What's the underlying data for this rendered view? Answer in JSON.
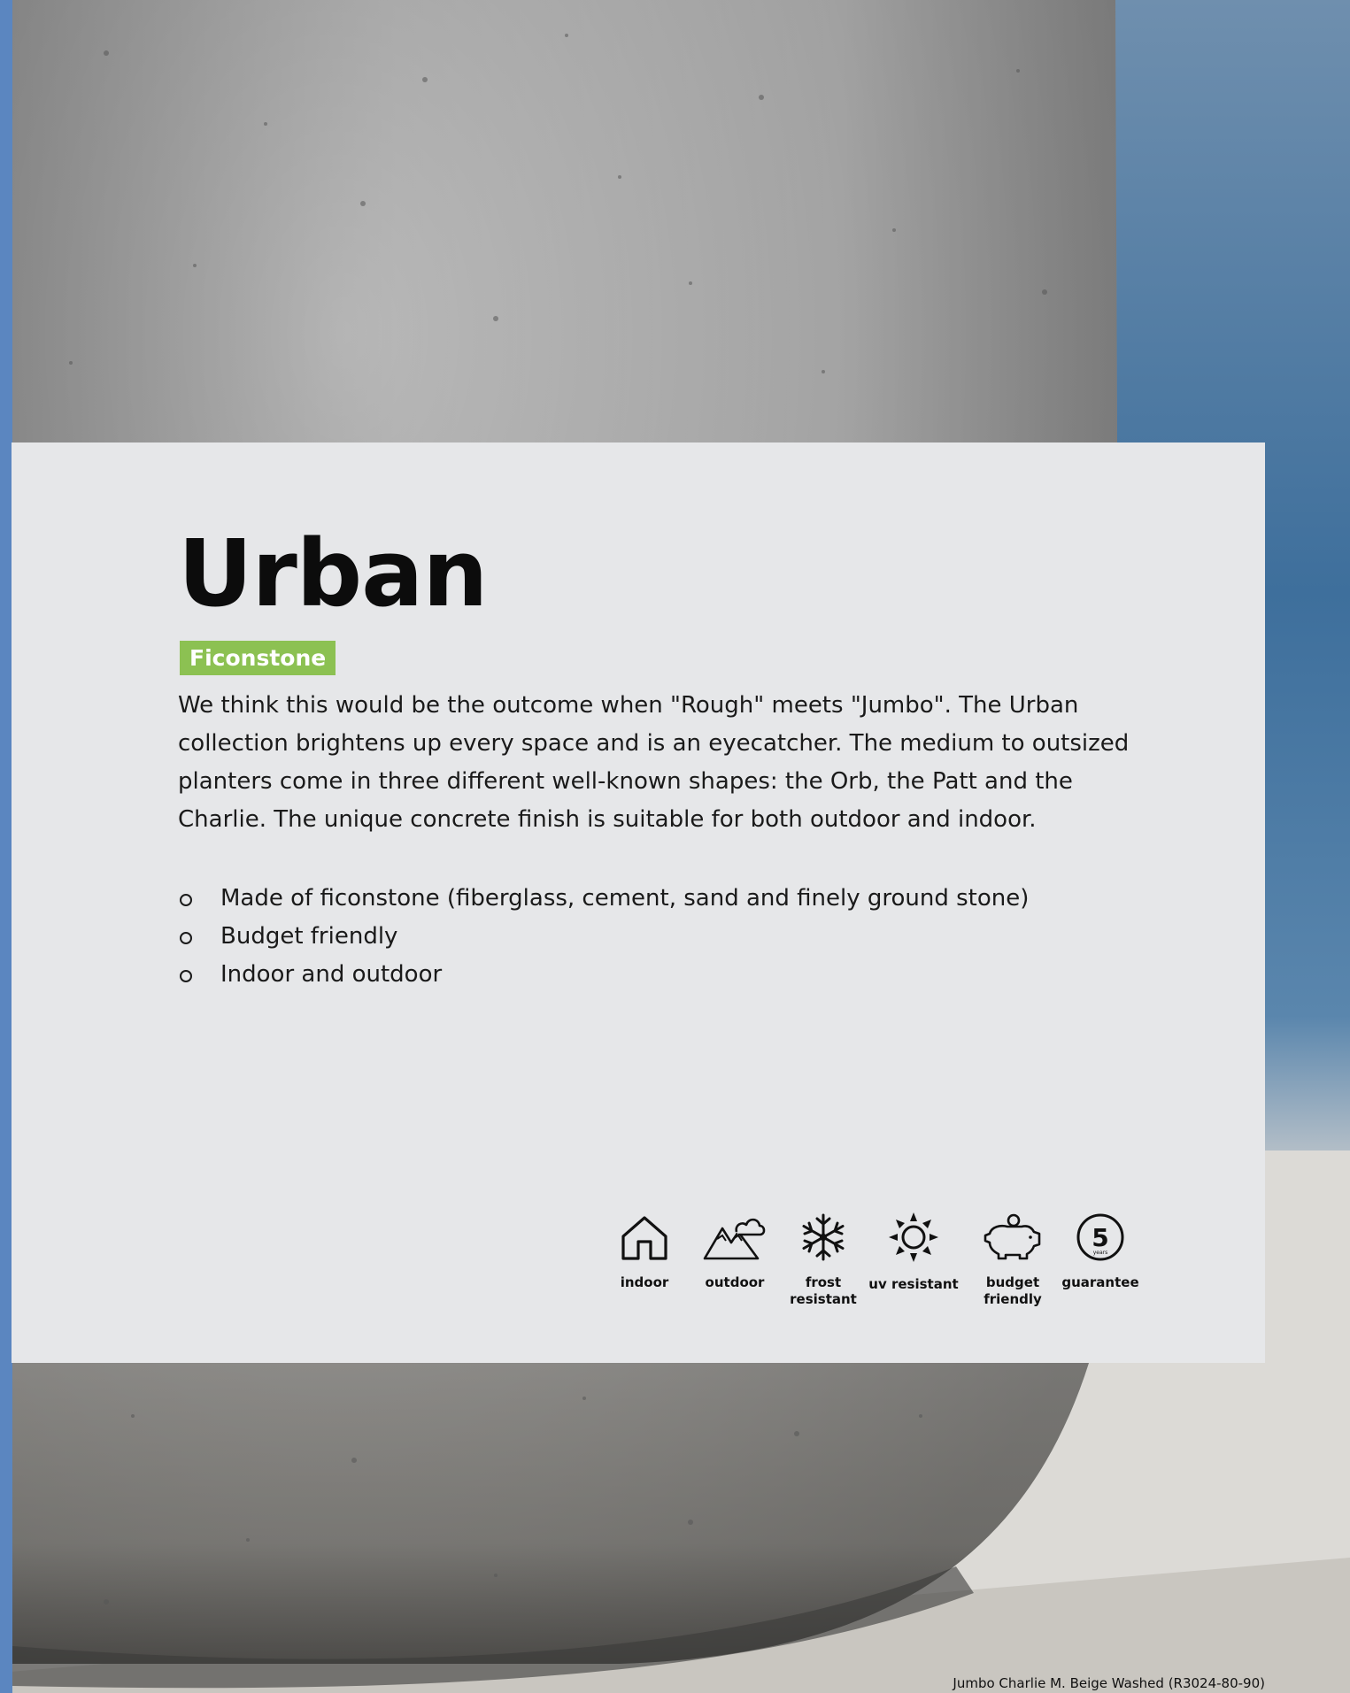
{
  "collection": {
    "title": "Urban",
    "material_badge": "Ficonstone",
    "description": "We think this would be the outcome when \"Rough\" meets \"Jumbo\". The Urban collection brightens up every space and is an eyecatcher. The medium to outsized planters come in three different well-known  shapes: the Orb, the Patt and the Charlie. The unique concrete finish is suitable for both outdoor and indoor.",
    "bullets": [
      "Made of ficonstone (fiberglass, cement, sand and finely ground stone)",
      "Budget friendly",
      "Indoor and outdoor"
    ]
  },
  "features": [
    {
      "icon": "house-icon",
      "label": "indoor"
    },
    {
      "icon": "mountain-cloud-icon",
      "label": "outdoor"
    },
    {
      "icon": "snowflake-icon",
      "label": "frost resistant"
    },
    {
      "icon": "sun-icon",
      "label": "uv resistant"
    },
    {
      "icon": "piggy-bank-icon",
      "label": "budget friendly"
    },
    {
      "icon": "guarantee-badge-icon",
      "label": "guarantee",
      "badge_number": "5",
      "badge_unit": "years"
    }
  ],
  "photo_caption": "Jumbo Charlie M. Beige Washed (R3024-80-90)",
  "colors": {
    "badge": "#8cc152",
    "panel": "#e6e7e9",
    "text": "#0c0c0c"
  }
}
